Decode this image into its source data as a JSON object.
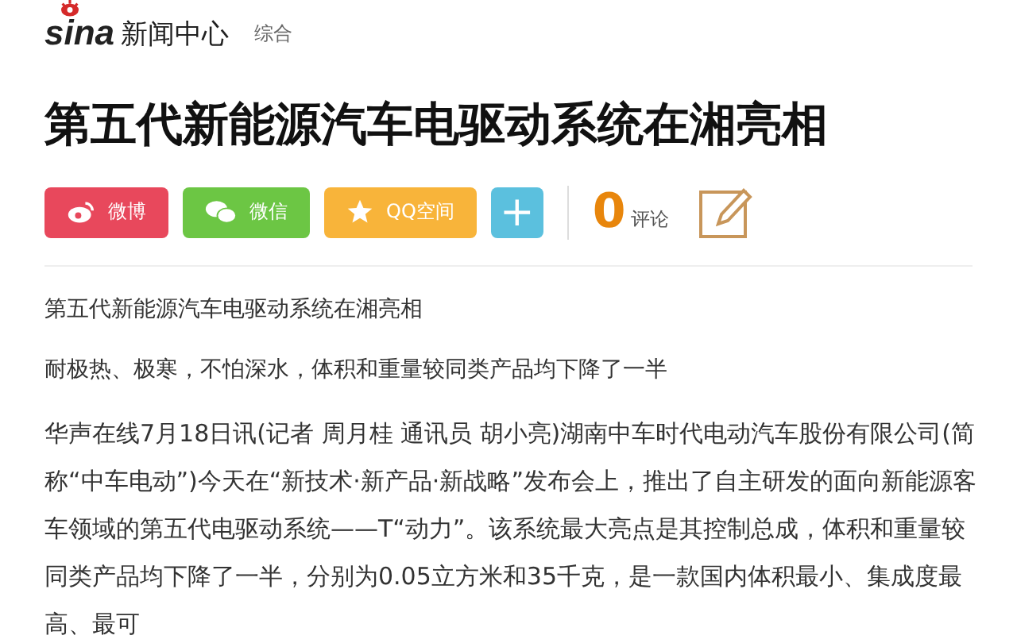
{
  "header": {
    "logo": "sina",
    "site": "新闻中心",
    "channel": "综合"
  },
  "title": "第五代新能源汽车电驱动系统在湘亮相",
  "share": [
    {
      "kind": "weibo",
      "label": "微博"
    },
    {
      "kind": "wechat",
      "label": "微信"
    },
    {
      "kind": "qzone",
      "label": "QQ空间"
    },
    {
      "kind": "more",
      "label": "+"
    }
  ],
  "comments": {
    "count": "0",
    "label": "评论"
  },
  "body": [
    "第五代新能源汽车电驱动系统在湘亮相",
    "耐极热、极寒，不怕深水，体积和重量较同类产品均下降了一半",
    "华声在线7月18日讯(记者 周月桂 通讯员 胡小亮)湖南中车时代电动汽车股份有限公司(简称“中车电动”)今天在“新技术·新产品·新战略”发布会上，推出了自主研发的面向新能源客车领域的第五代电驱动系统——T“动力”。该系统最大亮点是其控制总成，体积和重量较同类产品均下降了一半，分别为0.05立方米和35千克，是一款国内体积最小、集成度最高、最可"
  ]
}
